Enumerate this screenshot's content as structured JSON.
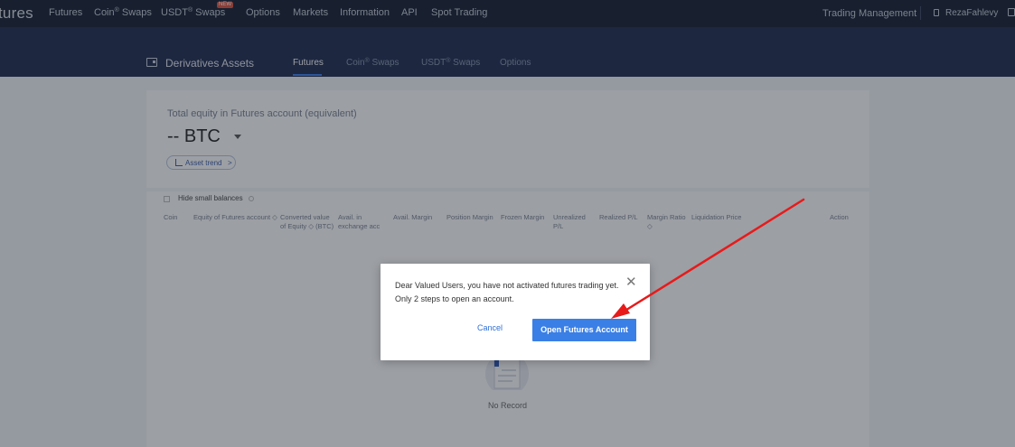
{
  "topnav": {
    "logo": "tures",
    "items": [
      {
        "label": "Futures"
      },
      {
        "label": "Coin",
        "sup": "®",
        "suffix": " Swaps"
      },
      {
        "label": "USDT",
        "sup": "®",
        "suffix": " Swaps",
        "badge": "NEW"
      },
      {
        "label": "Options"
      },
      {
        "label": "Markets"
      },
      {
        "label": "Information"
      },
      {
        "label": "API"
      },
      {
        "label": "Spot Trading"
      }
    ],
    "trading_management": "Trading Management",
    "username": "RezaFahlevy"
  },
  "subheader": {
    "title": "Derivatives Assets",
    "tabs": [
      {
        "label": "Futures"
      },
      {
        "label": "Coin",
        "sup": "®",
        "suffix": " Swaps"
      },
      {
        "label": "USDT",
        "sup": "®",
        "suffix": " Swaps"
      },
      {
        "label": "Options"
      }
    ],
    "active_tab": "Futures"
  },
  "equity": {
    "label": "Total equity in Futures account (equivalent)",
    "value": "-- BTC",
    "trend_button": "Asset trend",
    "trend_chevron": ">"
  },
  "table": {
    "hide_small_label": "Hide small balances",
    "columns": [
      "Coin",
      "Equity of Futures account ◇",
      "Converted value of Equity ◇ (BTC)",
      "Avail. in exchange acc",
      "Avail. Margin",
      "Position Margin",
      "Frozen Margin",
      "Unrealized P/L",
      "Realized P/L",
      "Margin Ratio ◇",
      "Liquidation Price",
      "Action"
    ],
    "empty_text": "No Record"
  },
  "dialog": {
    "message": "Dear Valued Users, you have not activated futures trading yet. Only 2 steps to open an account.",
    "close_glyph": "✕",
    "cancel_label": "Cancel",
    "open_label": "Open Futures Account"
  },
  "colors": {
    "nav_bg": "#141d30",
    "subheader_bg": "#1d2a4d",
    "primary": "#3a7fe6",
    "annotation_arrow": "#e81a1a"
  }
}
